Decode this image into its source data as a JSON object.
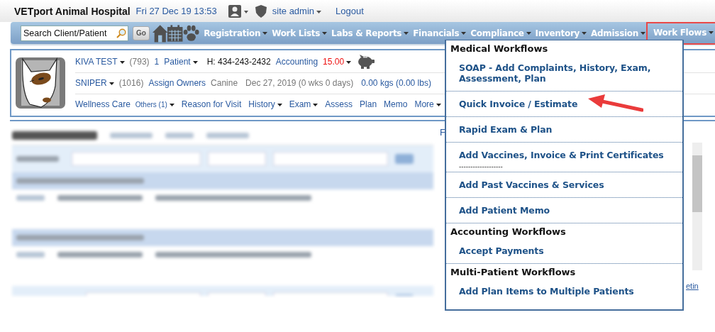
{
  "header": {
    "app_title": "VETport Animal Hospital",
    "datetime": "Fri 27 Dec 19 13:53",
    "user": "site admin",
    "logout": "Logout"
  },
  "nav": {
    "search": {
      "placeholder": "Search Client/Patient"
    },
    "go": "Go",
    "menus": [
      {
        "label": "Registration",
        "highlighted": false
      },
      {
        "label": "Work Lists",
        "highlighted": false
      },
      {
        "label": "Labs & Reports",
        "highlighted": false
      },
      {
        "label": "Financials",
        "highlighted": false
      },
      {
        "label": "Compliance",
        "highlighted": false
      },
      {
        "label": "Inventory",
        "highlighted": false
      },
      {
        "label": "Admission",
        "highlighted": false
      },
      {
        "label": "Work Flows",
        "highlighted": true
      }
    ]
  },
  "client": {
    "name": "KIVA TEST",
    "id": "(793)",
    "patient_count": "1",
    "patient_label": "Patient",
    "phone": "H: 434-243-2432",
    "accounting_label": "Accounting",
    "balance": "15.00"
  },
  "patient": {
    "name": "SNIPER",
    "id": "(1016)",
    "assign": "Assign Owners",
    "species": "Canine",
    "dob": "Dec 27, 2019 (0 wks 0 days)",
    "weight": "0.00 kgs (0.00 lbs)"
  },
  "tabs": [
    {
      "label": "Wellness Care",
      "kind": "plain"
    },
    {
      "label": "Others (1)",
      "kind": "small"
    },
    {
      "label": "Reason for Visit",
      "kind": "plain"
    },
    {
      "label": "History",
      "kind": "dropdown"
    },
    {
      "label": "Exam",
      "kind": "dropdown"
    },
    {
      "label": "Assess",
      "kind": "plain"
    },
    {
      "label": "Plan",
      "kind": "plain"
    },
    {
      "label": "Memo",
      "kind": "plain"
    },
    {
      "label": "More",
      "kind": "dropdown"
    }
  ],
  "background": {
    "fragment_left": "F",
    "fragment_link": "etin"
  },
  "workflows_menu": {
    "items": [
      {
        "label": "Medical Workflows",
        "kind": "header"
      },
      {
        "label": "SOAP - Add Complaints, History, Exam, Assessment, Plan",
        "kind": "item",
        "pointed": false
      },
      {
        "label": "Quick Invoice / Estimate",
        "kind": "item",
        "pointed": true
      },
      {
        "label": "Rapid Exam & Plan",
        "kind": "item",
        "pointed": false
      },
      {
        "label": "Add Vaccines, Invoice & Print Certificates",
        "kind": "item",
        "pointed": false
      },
      {
        "label": "-------------------",
        "kind": "rule"
      },
      {
        "label": "Add Past Vaccines & Services",
        "kind": "item",
        "pointed": false
      },
      {
        "label": "Add Patient Memo",
        "kind": "item",
        "pointed": false
      },
      {
        "label": "Accounting Workflows",
        "kind": "header"
      },
      {
        "label": "Accept Payments",
        "kind": "item",
        "pointed": false
      },
      {
        "label": "Multi-Patient Workflows",
        "kind": "header"
      },
      {
        "label": "Add Plan Items to Multiple Patients",
        "kind": "item",
        "pointed": false
      }
    ]
  }
}
